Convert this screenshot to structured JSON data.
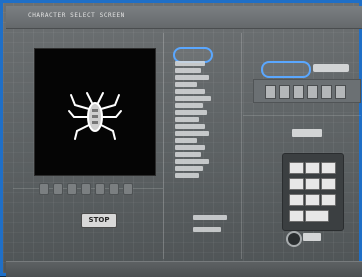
{
  "window": {
    "title": "CHARACTER SELECT SCREEN"
  },
  "display": {
    "stop_label": "STOP"
  },
  "colors": {
    "frame_border": "#1f6fc7",
    "panel_gray": "#5b6062",
    "highlight": "#5aa7ff"
  },
  "icons": {
    "creature": "insect-icon"
  }
}
